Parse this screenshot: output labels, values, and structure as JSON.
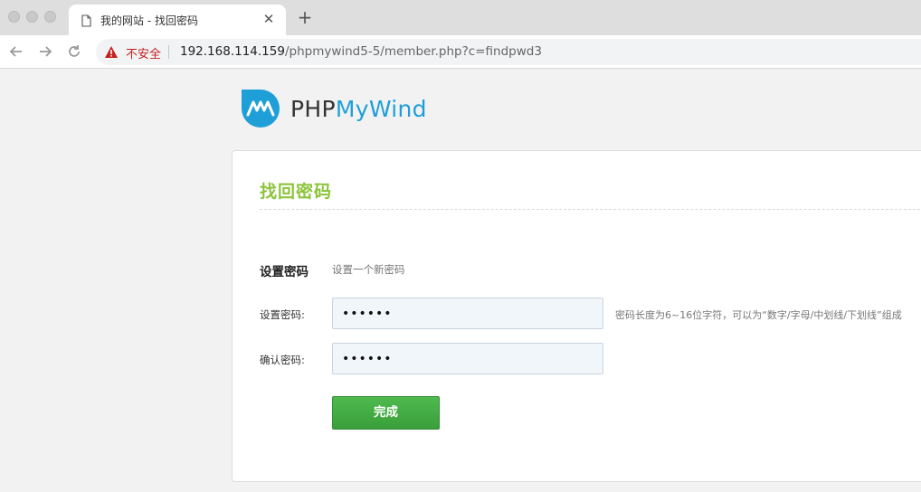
{
  "browser": {
    "tab_title": "我的网站 - 找回密码",
    "close_tab_glyph": "✕",
    "new_tab_glyph": "+",
    "security_label": "不安全",
    "url_host": "192.168.114.159",
    "url_path": "/phpmywind5-5/member.php?c=findpwd3",
    "colors": {
      "insecure": "#c5221f"
    }
  },
  "logo": {
    "part1": "PHP",
    "part2": "MyWind",
    "colors": {
      "brand": "#1f9fd8"
    }
  },
  "form": {
    "title": "找回密码",
    "section_title": "设置密码",
    "section_desc": "设置一个新密码",
    "password_label": "设置密码:",
    "password_value": "aaaaaa",
    "password_hint": "密码长度为6~16位字符，可以为“数字/字母/中划线/下划线”组成",
    "confirm_label": "确认密码:",
    "confirm_value": "aaaaaa",
    "submit_label": "完成",
    "colors": {
      "title": "#8cc43a",
      "submit": "#3fa83f"
    }
  }
}
